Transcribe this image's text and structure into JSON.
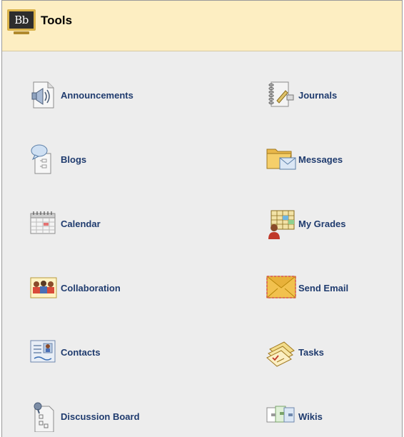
{
  "header": {
    "title": "Tools",
    "logo_text": "Bb"
  },
  "tools": {
    "announcements": {
      "label": "Announcements",
      "icon": "speaker-document-icon"
    },
    "blogs": {
      "label": "Blogs",
      "icon": "blog-icon"
    },
    "calendar": {
      "label": "Calendar",
      "icon": "calendar-icon"
    },
    "collaboration": {
      "label": "Collaboration",
      "icon": "collaboration-icon"
    },
    "contacts": {
      "label": "Contacts",
      "icon": "contact-card-icon"
    },
    "discussion_board": {
      "label": "Discussion Board",
      "icon": "discussion-board-icon"
    },
    "journals": {
      "label": "Journals",
      "icon": "journal-icon"
    },
    "messages": {
      "label": "Messages",
      "icon": "folder-envelope-icon"
    },
    "my_grades": {
      "label": "My Grades",
      "icon": "grades-icon"
    },
    "send_email": {
      "label": "Send Email",
      "icon": "envelope-icon"
    },
    "tasks": {
      "label": "Tasks",
      "icon": "tasks-icon"
    },
    "wikis": {
      "label": "Wikis",
      "icon": "wiki-pages-icon"
    }
  },
  "colors": {
    "header_bg": "#fdeec2",
    "panel_bg": "#ededed",
    "link": "#1f3b6e"
  }
}
